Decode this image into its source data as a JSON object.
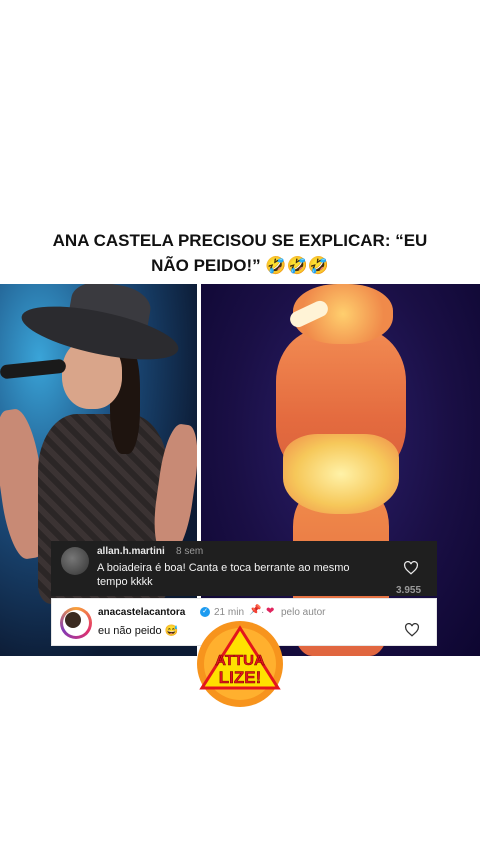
{
  "post": {
    "headline": "ANA CASTELA PRECISOU SE EXPLICAR: “EU NÃO PEIDO!” 🤣🤣🤣"
  },
  "comments": [
    {
      "username": "allan.h.martini",
      "time": "8 sem",
      "text": "A boiadeira é boa! Canta e toca berrante ao mesmo tempo kkkk",
      "likes": "3.955"
    },
    {
      "username": "anacastelacantora",
      "time": "21 min",
      "pinned": "📌",
      "separator": "·",
      "liked_by_author_heart": "❤",
      "liked_by_author_label": "pelo autor",
      "text": "eu não peido 😅"
    }
  ],
  "logo": {
    "line1": "ATTUA",
    "line2": "LIZE!",
    "colors": {
      "outer": "#f7941d",
      "inner": "#ffe100",
      "text": "#e3161c"
    }
  },
  "icons": {
    "heart": "heart-outline-icon",
    "verified": "verified-badge-icon",
    "pin": "pin-icon"
  }
}
